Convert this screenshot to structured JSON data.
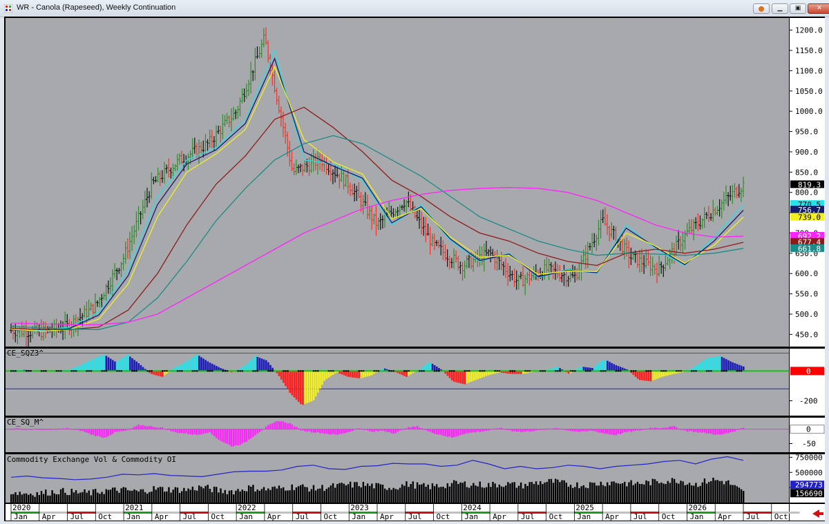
{
  "window": {
    "title": "WR - Canola (Rapeseed), Weekly Continuation",
    "buttons": [
      "help",
      "minimize",
      "maximize",
      "close"
    ],
    "colors": {
      "chart_bg": "#a8a9ad",
      "axis_bg": "#ffffff",
      "up_bar": "#2e8b2e",
      "down_bar": "#e8362c",
      "neutral_bar": "#111111"
    }
  },
  "chart_data": [
    {
      "type": "ohlc-price",
      "title": "WR - Canola (Rapeseed), Weekly Continuation",
      "ylim": [
        420,
        1230
      ],
      "y_ticks": [
        450,
        500,
        550,
        600,
        650,
        700,
        750,
        800,
        850,
        900,
        950,
        1000,
        1050,
        1100,
        1150,
        1200
      ],
      "y_tick_labels": [
        "450.0",
        "500.0",
        "550.0",
        "600.0",
        "650.0",
        "700.0",
        "750.0",
        "800.0",
        "850.0",
        "900.0",
        "950.0",
        "1000.0",
        "1050.0",
        "1100.0",
        "1150.0",
        "1200.0"
      ],
      "x": [
        "2020-01",
        "2020-04",
        "2020-07",
        "2020-10",
        "2021-01",
        "2021-04",
        "2021-07",
        "2021-10",
        "2022-01",
        "2022-04",
        "2022-07",
        "2022-10",
        "2023-01",
        "2023-04",
        "2023-07",
        "2023-10",
        "2024-01",
        "2024-04",
        "2024-07",
        "2024-10",
        "2025-01",
        "2025-04",
        "2025-07",
        "2025-10",
        "2026-01",
        "2026-04",
        "2026-07"
      ],
      "close": [
        460,
        455,
        470,
        520,
        640,
        820,
        880,
        920,
        1000,
        1180,
        850,
        880,
        820,
        720,
        780,
        670,
        620,
        650,
        580,
        610,
        590,
        730,
        640,
        610,
        700,
        760,
        819
      ],
      "price_labels": [
        {
          "label": "819.3",
          "value": 819.3,
          "bg": "#000000",
          "fg": "#ffffff"
        },
        {
          "label": "770.5",
          "value": 770.5,
          "bg": "#28e0e8",
          "fg": "#000000"
        },
        {
          "label": "756.7",
          "value": 756.7,
          "bg": "#141c6e",
          "fg": "#ffffff"
        },
        {
          "label": "739.0",
          "value": 739.0,
          "bg": "#f4f020",
          "fg": "#000000"
        },
        {
          "label": "692.2",
          "value": 692.2,
          "bg": "#ff22ff",
          "fg": "#ffffff"
        },
        {
          "label": "677.4",
          "value": 677.4,
          "bg": "#8e1a1a",
          "fg": "#ffffff"
        },
        {
          "label": "661.8",
          "value": 661.8,
          "bg": "#1c8a86",
          "fg": "#ffffff"
        }
      ],
      "series": [
        {
          "color": "#28e0e8",
          "values": [
            462,
            460,
            468,
            505,
            610,
            790,
            880,
            910,
            980,
            1150,
            880,
            870,
            830,
            720,
            770,
            680,
            630,
            650,
            590,
            610,
            600,
            720,
            660,
            620,
            690,
            770
          ]
        },
        {
          "color": "#141c6e",
          "values": [
            462,
            458,
            465,
            498,
            595,
            770,
            870,
            905,
            970,
            1130,
            900,
            865,
            835,
            725,
            765,
            685,
            632,
            648,
            592,
            608,
            602,
            712,
            665,
            622,
            680,
            756
          ]
        },
        {
          "color": "#f4f020",
          "values": [
            463,
            458,
            462,
            488,
            575,
            740,
            850,
            895,
            955,
            1110,
            930,
            875,
            845,
            735,
            760,
            690,
            640,
            645,
            598,
            606,
            605,
            700,
            668,
            625,
            670,
            739
          ]
        },
        {
          "color": "#8e1a1a",
          "values": [
            465,
            462,
            462,
            468,
            510,
            600,
            720,
            820,
            890,
            980,
            1010,
            960,
            900,
            830,
            790,
            740,
            700,
            680,
            650,
            630,
            620,
            650,
            660,
            650,
            660,
            677
          ]
        },
        {
          "color": "#1c8a86",
          "values": [
            470,
            466,
            463,
            462,
            480,
            540,
            630,
            730,
            810,
            880,
            920,
            940,
            920,
            880,
            840,
            790,
            740,
            710,
            680,
            660,
            645,
            650,
            648,
            645,
            650,
            662
          ]
        },
        {
          "color": "#ff22ff",
          "values": [
            478,
            476,
            474,
            474,
            480,
            500,
            540,
            580,
            620,
            660,
            700,
            730,
            760,
            780,
            795,
            805,
            810,
            812,
            810,
            800,
            780,
            750,
            720,
            700,
            690,
            692
          ]
        }
      ]
    },
    {
      "type": "histogram",
      "title": "CE_SQZ3^",
      "ylim": [
        -300,
        150
      ],
      "y_tick_labels": [
        "-200"
      ],
      "value_label": {
        "label": "0",
        "bg": "#ff0000",
        "fg": "#ffffff"
      },
      "reference_lines": [
        {
          "value": -120,
          "color": "#2222cc"
        },
        {
          "value": 120,
          "color": "#cc2222"
        }
      ],
      "colors": {
        "pos_up": "#28e0e8",
        "pos_down": "#1a1ab8",
        "neg_down": "#ff1e1e",
        "neg_up": "#f4f020"
      },
      "values": [
        5,
        8,
        3,
        -5,
        2,
        10,
        40,
        80,
        110,
        60,
        110,
        50,
        -20,
        -40,
        20,
        60,
        110,
        60,
        20,
        -10,
        30,
        100,
        70,
        -30,
        -150,
        -230,
        -200,
        -60,
        -10,
        -40,
        -50,
        -30,
        20,
        -5,
        -40,
        5,
        60,
        10,
        -70,
        -90,
        -60,
        -30,
        -10,
        -20,
        -20,
        -5,
        5,
        30,
        -20,
        30,
        20,
        80,
        40,
        10,
        -60,
        -70,
        -40,
        -20,
        -5,
        40,
        90,
        100,
        60,
        30
      ]
    },
    {
      "type": "histogram",
      "title": "CE_SQ_M^",
      "ylim": [
        -80,
        40
      ],
      "y_tick_labels": [
        "-50"
      ],
      "value_label": {
        "label": "0",
        "bg": "#ffffff",
        "fg": "#000000"
      },
      "color": "#ff22ff",
      "values": [
        2,
        1,
        0,
        -2,
        1,
        3,
        -5,
        -20,
        -30,
        -10,
        -5,
        15,
        10,
        5,
        -10,
        -15,
        -20,
        -10,
        -40,
        -60,
        -50,
        -20,
        10,
        30,
        20,
        -5,
        -10,
        -15,
        -20,
        -10,
        5,
        -10,
        -5,
        -15,
        5,
        10,
        -10,
        -20,
        -30,
        -15,
        -10,
        -5,
        5,
        -5,
        -10,
        -5,
        0,
        5,
        -5,
        -10,
        -5,
        -15,
        -20,
        -10,
        -5,
        5,
        5,
        10,
        -5,
        -10,
        -15,
        -20,
        -10,
        5
      ]
    },
    {
      "type": "bar+line",
      "title": "Commodity Exchange Vol & Commodity OI",
      "ylim": [
        0,
        800000
      ],
      "y_ticks": [
        250000,
        500000,
        750000
      ],
      "y_tick_labels": [
        "250000",
        "500000",
        "750000"
      ],
      "value_labels": [
        {
          "label": "294773",
          "value": 294773,
          "bg": "#2222cc",
          "fg": "#ffffff"
        },
        {
          "label": "156690",
          "value": 156690,
          "bg": "#000000",
          "fg": "#ffffff"
        }
      ],
      "oi_values": [
        420,
        440,
        410,
        400,
        380,
        390,
        420,
        470,
        460,
        480,
        450,
        440,
        430,
        470,
        510,
        520,
        520,
        540,
        600,
        620,
        560,
        550,
        600,
        610,
        650,
        640,
        640,
        600,
        620,
        700,
        640,
        560,
        600,
        560,
        580,
        620,
        600,
        560,
        600,
        620,
        640,
        680,
        700,
        640,
        720,
        760,
        700
      ],
      "vol_values": [
        180,
        150,
        160,
        190,
        170,
        160,
        200,
        210,
        180,
        230,
        220,
        210,
        260,
        200,
        190,
        250,
        220,
        240,
        270,
        230,
        260,
        290,
        300,
        270,
        250,
        310,
        260,
        280,
        320,
        300,
        290,
        310,
        280,
        330,
        350,
        300,
        290,
        320,
        340,
        310,
        330,
        360,
        370,
        300,
        380,
        340,
        160
      ]
    }
  ],
  "time_axis": {
    "year_labels": [
      "2020",
      "2021",
      "2022",
      "2023",
      "2024",
      "2025",
      "2026"
    ],
    "month_labels": [
      "Jan",
      "Apr",
      "Jul",
      "Oct",
      "Jan",
      "Apr",
      "Jul",
      "Oct",
      "Jan",
      "Apr",
      "Jul",
      "Oct",
      "Jan",
      "Apr",
      "Jul",
      "Oct",
      "Jan",
      "Apr",
      "Jul",
      "Oct",
      "Jan",
      "Apr",
      "Jul",
      "Oct",
      "Jan",
      "Apr",
      "Jul",
      "Oct"
    ]
  }
}
